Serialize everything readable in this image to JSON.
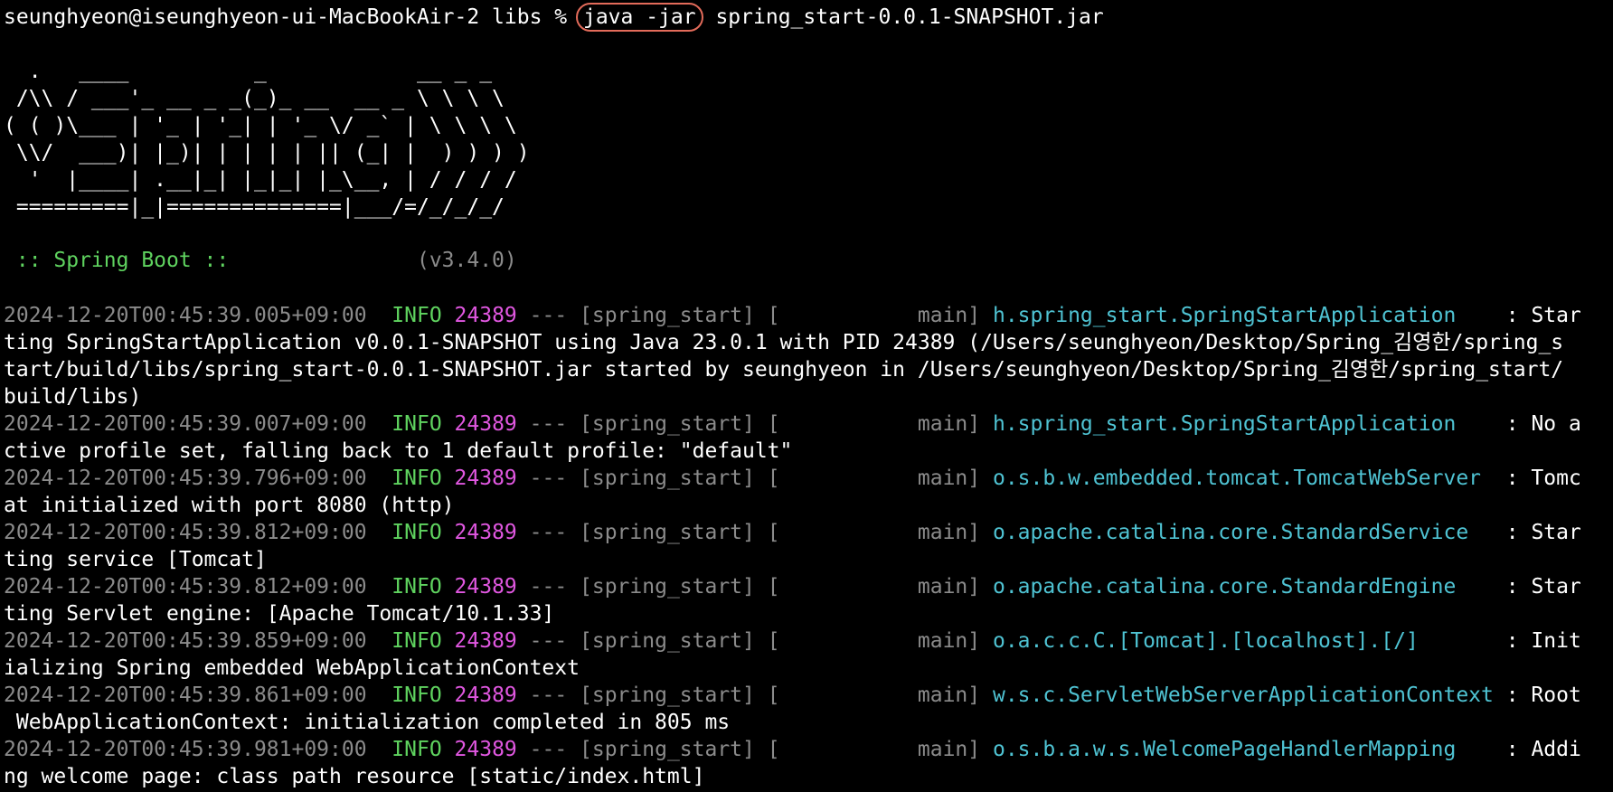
{
  "terminal": {
    "prompt": "seunghyeon@iseunghyeon-ui-MacBookAir-2 libs % ",
    "command_highlighted": "java -jar",
    "command_rest": " spring_start-0.0.1-SNAPSHOT.jar",
    "highlight_color": "#e36b5a",
    "banner_lines": [
      "  .   ____          _            __ _ _",
      " /\\\\ / ___'_ __ _ _(_)_ __  __ _ \\ \\ \\ \\",
      "( ( )\\___ | '_ | '_| | '_ \\/ _` | \\ \\ \\ \\",
      " \\\\/  ___)| |_)| | | | | || (_| |  ) ) ) )",
      "  '  |____| .__|_| |_|_| |_\\__, | / / / /",
      " =========|_|==============|___/=/_/_/_/"
    ],
    "boot_label": " :: Spring Boot :: ",
    "boot_version": "              (v3.4.0)",
    "logs": [
      {
        "timestamp": "2024-12-20T00:45:39.005+09:00",
        "level": "INFO",
        "pid": "24389",
        "sep": " --- [spring_start] [           main] ",
        "logger": "h.spring_start.SpringStartApplication",
        "logger_pad": "    : ",
        "message_lines": [
          "Star",
          "ting SpringStartApplication v0.0.1-SNAPSHOT using Java 23.0.1 with PID 24389 (/Users/seunghyeon/Desktop/Spring_김영한/spring_s",
          "tart/build/libs/spring_start-0.0.1-SNAPSHOT.jar started by seunghyeon in /Users/seunghyeon/Desktop/Spring_김영한/spring_start/",
          "build/libs)"
        ]
      },
      {
        "timestamp": "2024-12-20T00:45:39.007+09:00",
        "level": "INFO",
        "pid": "24389",
        "sep": " --- [spring_start] [           main] ",
        "logger": "h.spring_start.SpringStartApplication",
        "logger_pad": "    : ",
        "message_lines": [
          "No a",
          "ctive profile set, falling back to 1 default profile: \"default\""
        ]
      },
      {
        "timestamp": "2024-12-20T00:45:39.796+09:00",
        "level": "INFO",
        "pid": "24389",
        "sep": " --- [spring_start] [           main] ",
        "logger": "o.s.b.w.embedded.tomcat.TomcatWebServer",
        "logger_pad": "  : ",
        "message_lines": [
          "Tomc",
          "at initialized with port 8080 (http)"
        ]
      },
      {
        "timestamp": "2024-12-20T00:45:39.812+09:00",
        "level": "INFO",
        "pid": "24389",
        "sep": " --- [spring_start] [           main] ",
        "logger": "o.apache.catalina.core.StandardService",
        "logger_pad": "   : ",
        "message_lines": [
          "Star",
          "ting service [Tomcat]"
        ]
      },
      {
        "timestamp": "2024-12-20T00:45:39.812+09:00",
        "level": "INFO",
        "pid": "24389",
        "sep": " --- [spring_start] [           main] ",
        "logger": "o.apache.catalina.core.StandardEngine",
        "logger_pad": "    : ",
        "message_lines": [
          "Star",
          "ting Servlet engine: [Apache Tomcat/10.1.33]"
        ]
      },
      {
        "timestamp": "2024-12-20T00:45:39.859+09:00",
        "level": "INFO",
        "pid": "24389",
        "sep": " --- [spring_start] [           main] ",
        "logger": "o.a.c.c.C.[Tomcat].[localhost].[/]",
        "logger_pad": "       : ",
        "message_lines": [
          "Init",
          "ializing Spring embedded WebApplicationContext"
        ]
      },
      {
        "timestamp": "2024-12-20T00:45:39.861+09:00",
        "level": "INFO",
        "pid": "24389",
        "sep": " --- [spring_start] [           main] ",
        "logger": "w.s.c.ServletWebServerApplicationContext",
        "logger_pad": " : ",
        "message_lines": [
          "Root",
          " WebApplicationContext: initialization completed in 805 ms"
        ]
      },
      {
        "timestamp": "2024-12-20T00:45:39.981+09:00",
        "level": "INFO",
        "pid": "24389",
        "sep": " --- [spring_start] [           main] ",
        "logger": "o.s.b.a.w.s.WelcomePageHandlerMapping",
        "logger_pad": "    : ",
        "message_lines": [
          "Addi",
          "ng welcome page: class path resource [static/index.html]"
        ]
      }
    ]
  }
}
